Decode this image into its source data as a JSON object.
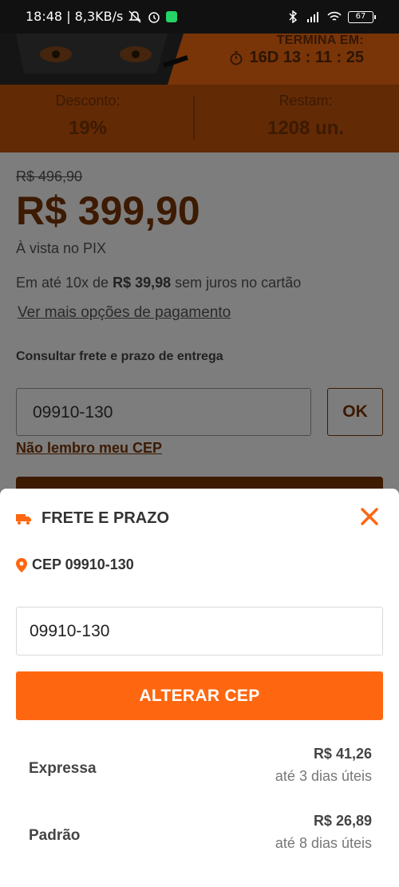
{
  "status_bar": {
    "time_speed": "18:48 | 8,3KB/s",
    "battery": "67",
    "icons": [
      "mute-bell-icon",
      "alarm-icon",
      "whatsapp-icon",
      "bluetooth-icon",
      "signal-icon",
      "wifi-icon",
      "battery-icon"
    ]
  },
  "timer": {
    "title": "TERMINA EM:",
    "value": "16D 13 : 11 : 25"
  },
  "stats": {
    "discount_label": "Desconto:",
    "discount_value": "19%",
    "remaining_label": "Restam:",
    "remaining_value": "1208 un."
  },
  "pricing": {
    "old_price": "R$ 496,90",
    "price": "R$ 399,90",
    "pix_text": "À vista no PIX",
    "install_prefix": "Em até 10x de ",
    "install_amount": "R$ 39,98",
    "install_suffix": " sem juros no cartão",
    "more_payment": "Ver mais opções de pagamento"
  },
  "shipping": {
    "title": "Consultar frete e prazo de entrega",
    "cep_value": "09910-130",
    "ok_label": "OK",
    "forgot_label": "Não lembro meu CEP"
  },
  "sheet": {
    "title": "FRETE E PRAZO",
    "cep_line": "CEP 09910-130",
    "input_value": "09910-130",
    "change_label": "ALTERAR CEP",
    "options": [
      {
        "name": "Expressa",
        "price": "R$ 41,26",
        "days": "até 3 dias úteis"
      },
      {
        "name": "Padrão",
        "price": "R$ 26,89",
        "days": "até 8 dias úteis"
      }
    ]
  },
  "colors": {
    "accent": "#fe6710",
    "dark_text": "#333333"
  }
}
